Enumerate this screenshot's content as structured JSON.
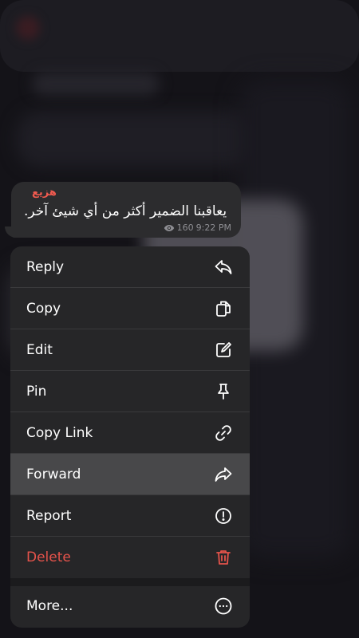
{
  "message": {
    "sender": "هزيع",
    "text": "يعاقبنا الضمير أكثر من أي شيئ آخر.",
    "views": "160",
    "time": "9:22 PM"
  },
  "menu": {
    "items": [
      {
        "label": "Reply",
        "icon": "reply-icon"
      },
      {
        "label": "Copy",
        "icon": "copy-icon"
      },
      {
        "label": "Edit",
        "icon": "edit-icon"
      },
      {
        "label": "Pin",
        "icon": "pin-icon"
      },
      {
        "label": "Copy Link",
        "icon": "link-icon"
      },
      {
        "label": "Forward",
        "icon": "forward-icon"
      },
      {
        "label": "Report",
        "icon": "report-icon"
      },
      {
        "label": "Delete",
        "icon": "trash-icon"
      }
    ],
    "more": {
      "label": "More...",
      "icon": "more-icon"
    }
  },
  "colors": {
    "danger": "#e5534b",
    "sender": "#ef5a4f",
    "highlight": "#48484a"
  }
}
